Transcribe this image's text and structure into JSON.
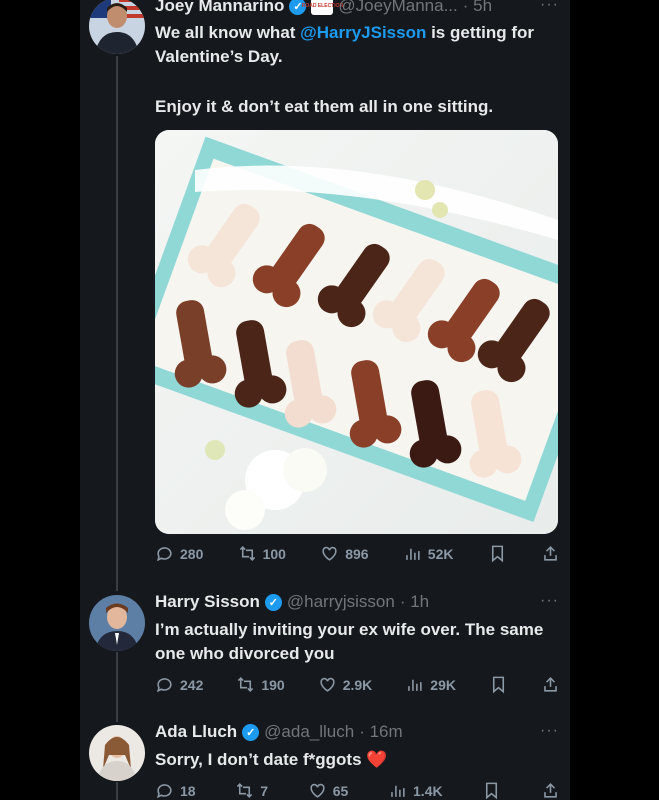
{
  "tweet1": {
    "name": "Joey Mannarino",
    "badge": "ROAD ELECTION",
    "handle": "@JoeyManna...",
    "time": "· 5h",
    "text_pre": "We all know what ",
    "mention": "@HarryJSisson",
    "text_post": " is getting for Valentine’s Day.",
    "text2": "Enjoy it & don’t eat them all in one sitting.",
    "replies": "280",
    "reposts": "100",
    "likes": "896",
    "views": "52K"
  },
  "tweet2": {
    "name": "Harry Sisson",
    "handle": "@harryjsisson",
    "time": "· 1h",
    "text": "I’m actually inviting your ex wife over. The same one who divorced you",
    "replies": "242",
    "reposts": "190",
    "likes": "2.9K",
    "views": "29K"
  },
  "tweet3": {
    "name": "Ada Lluch",
    "handle": "@ada_lluch",
    "time": "· 16m",
    "text": "Sorry, I don’t date f*ggots",
    "emoji": "❤️",
    "replies": "18",
    "reposts": "7",
    "likes": "65",
    "views": "1.4K"
  },
  "more_menu": "···",
  "icons": [
    "reply-icon",
    "repost-icon",
    "like-icon",
    "views-icon",
    "bookmark-icon",
    "share-icon",
    "verified-icon"
  ],
  "colors": {
    "accent": "#1d9bf0",
    "background": "#15181c",
    "muted": "#71767b"
  }
}
